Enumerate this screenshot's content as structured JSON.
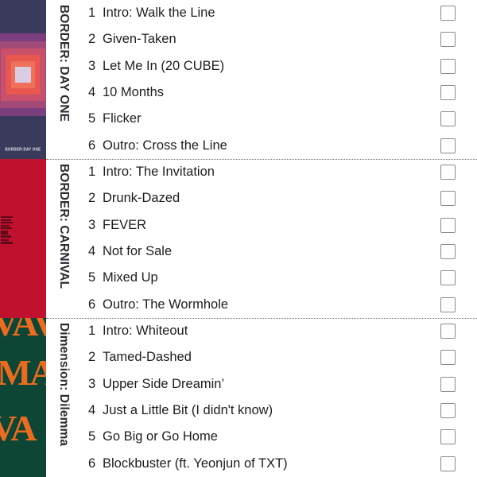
{
  "page": {
    "type": "album-tracklist-checklist",
    "background": "#ffffff",
    "text_color": "#1d1d1f"
  },
  "albums": [
    {
      "spine_label": "BORDER: DAY ONE",
      "cover": {
        "name": "border-day-one-cover",
        "background": "#3a3a5c",
        "accent_colors": [
          "#7b3f80",
          "#a24a78",
          "#c9506a",
          "#e9584f",
          "#f0705c",
          "#d9cde4"
        ],
        "caption": "BORDER:DAY ONE"
      },
      "tracks": [
        {
          "num": "1",
          "title": "Intro: Walk the Line"
        },
        {
          "num": "2",
          "title": "Given-Taken"
        },
        {
          "num": "3",
          "title": "Let Me In (20 CUBE)"
        },
        {
          "num": "4",
          "title": "10 Months"
        },
        {
          "num": "5",
          "title": "Flicker"
        },
        {
          "num": "6",
          "title": "Outro: Cross the Line"
        }
      ]
    },
    {
      "spine_label": "BORDER: CARNIVAL",
      "cover": {
        "name": "border-carnival-cover",
        "background": "#c0112f",
        "accent_colors": [
          "#5d0a1a"
        ],
        "caption": ""
      },
      "tracks": [
        {
          "num": "1",
          "title": "Intro: The Invitation"
        },
        {
          "num": "2",
          "title": "Drunk-Dazed"
        },
        {
          "num": "3",
          "title": "FEVER"
        },
        {
          "num": "4",
          "title": "Not for Sale"
        },
        {
          "num": "5",
          "title": "Mixed Up"
        },
        {
          "num": "6",
          "title": "Outro: The Wormhole"
        }
      ]
    },
    {
      "spine_label": "Dimension: Dilemma",
      "cover": {
        "name": "dimension-dilemma-cover",
        "background": "#0e4635",
        "accent_colors": [
          "#ec6b1e"
        ],
        "caption": "",
        "glyph_rows": [
          "VAV",
          "MA",
          "VA"
        ]
      },
      "tracks": [
        {
          "num": "1",
          "title": "Intro: Whiteout"
        },
        {
          "num": "2",
          "title": "Tamed-Dashed"
        },
        {
          "num": "3",
          "title": "Upper Side Dreamin’"
        },
        {
          "num": "4",
          "title": "Just a Little Bit (I didn't know)"
        },
        {
          "num": "5",
          "title": "Go Big or Go Home"
        },
        {
          "num": "6",
          "title": "Blockbuster (ft. Yeonjun of TXT)"
        }
      ]
    }
  ],
  "checkbox": {
    "label": "track-checkbox",
    "checked": false,
    "border_color": "#8b8b8b"
  }
}
